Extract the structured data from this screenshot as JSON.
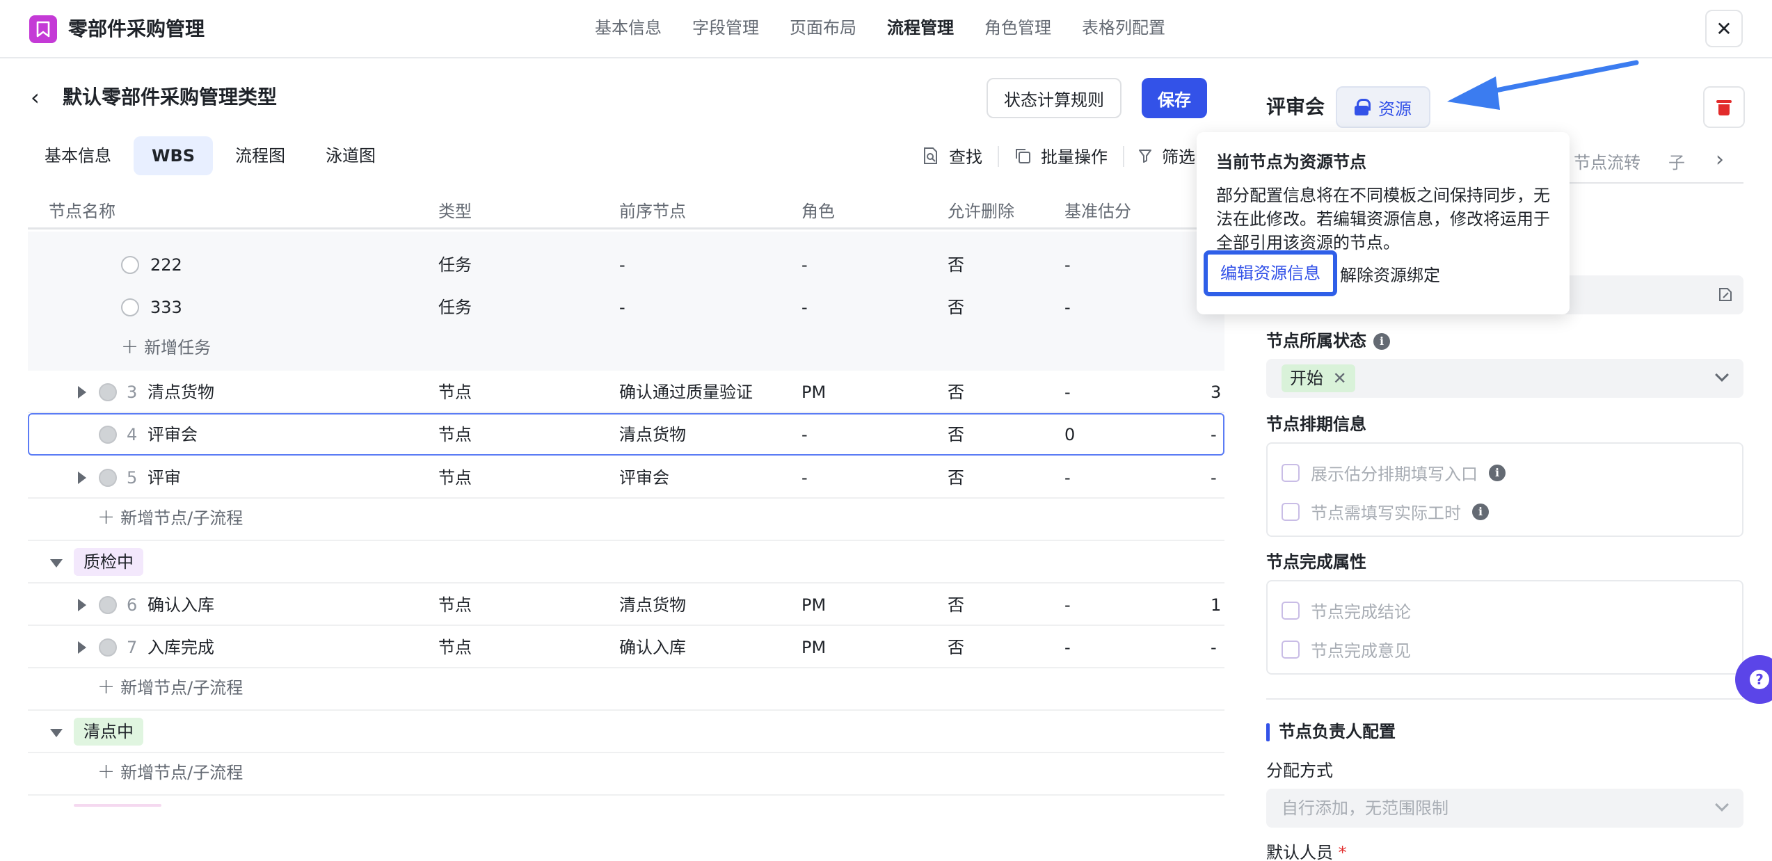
{
  "app": {
    "title": "零部件采购管理",
    "nav": [
      "基本信息",
      "字段管理",
      "页面布局",
      "流程管理",
      "角色管理",
      "表格列配置"
    ],
    "active_nav": "流程管理",
    "close_glyph": "✕"
  },
  "page": {
    "back_glyph": "‹",
    "title": "默认零部件采购管理类型",
    "rule_button": "状态计算规则",
    "save_button": "保存"
  },
  "subtabs": [
    "基本信息",
    "WBS",
    "流程图",
    "泳道图"
  ],
  "active_subtab": "WBS",
  "toolbar": {
    "find": "查找",
    "batch": "批量操作",
    "filter": "筛选"
  },
  "table": {
    "headers": [
      "节点名称",
      "类型",
      "前序节点",
      "角色",
      "允许删除",
      "基准估分"
    ],
    "rows": [
      {
        "kind": "task",
        "name": "222",
        "type": "任务",
        "prev": "-",
        "role": "-",
        "deletable": "否",
        "estimate": "-",
        "extra": ""
      },
      {
        "kind": "task",
        "name": "333",
        "type": "任务",
        "prev": "-",
        "role": "-",
        "deletable": "否",
        "estimate": "-",
        "extra": ""
      },
      {
        "kind": "add_task",
        "label": "新增任务"
      },
      {
        "kind": "node",
        "num": "3",
        "name": "清点货物",
        "type": "节点",
        "prev": "确认通过质量验证",
        "role": "PM",
        "deletable": "否",
        "estimate": "-",
        "extra": "3"
      },
      {
        "kind": "node",
        "num": "4",
        "name": "评审会",
        "type": "节点",
        "prev": "清点货物",
        "role": "-",
        "deletable": "否",
        "estimate": "0",
        "extra": "-"
      },
      {
        "kind": "node",
        "num": "5",
        "name": "评审",
        "type": "节点",
        "prev": "评审会",
        "role": "-",
        "deletable": "否",
        "estimate": "-",
        "extra": "-"
      },
      {
        "kind": "add_node",
        "label": "新增节点/子流程"
      },
      {
        "kind": "group",
        "label": "质检中",
        "color": "#f3e8fc"
      },
      {
        "kind": "node",
        "num": "6",
        "name": "确认入库",
        "type": "节点",
        "prev": "清点货物",
        "role": "PM",
        "deletable": "否",
        "estimate": "-",
        "extra": "1"
      },
      {
        "kind": "node",
        "num": "7",
        "name": "入库完成",
        "type": "节点",
        "prev": "确认入库",
        "role": "PM",
        "deletable": "否",
        "estimate": "-",
        "extra": "-"
      },
      {
        "kind": "add_node",
        "label": "新增节点/子流程"
      },
      {
        "kind": "group",
        "label": "清点中",
        "color": "#e0f5e0"
      },
      {
        "kind": "add_node",
        "label": "新增节点/子流程"
      }
    ]
  },
  "panel": {
    "node_title": "评审会",
    "resource_badge": "资源",
    "tabs": [
      "节点流转",
      "子"
    ],
    "state_label": "节点所属状态",
    "state_value": "开始",
    "schedule_label": "节点排期信息",
    "schedule_options": [
      "展示估分排期填写入口",
      "节点需填写实际工时"
    ],
    "complete_label": "节点完成属性",
    "complete_options": [
      "节点完成结论",
      "节点完成意见"
    ],
    "owner_section": "节点负责人配置",
    "assign_label": "分配方式",
    "assign_placeholder": "自行添加，无范围限制",
    "default_person_label": "默认人员",
    "required_mark": "*"
  },
  "popover": {
    "title": "当前节点为资源节点",
    "body": "部分配置信息将在不同模板之间保持同步，无法在此修改。若编辑资源信息，修改将运用于全部引用该资源的节点。",
    "edit_action": "编辑资源信息",
    "unbind_action": "解除资源绑定"
  },
  "colors": {
    "primary": "#3352e8",
    "danger": "#e22b2b",
    "annotation_arrow": "#3b7cf0"
  }
}
